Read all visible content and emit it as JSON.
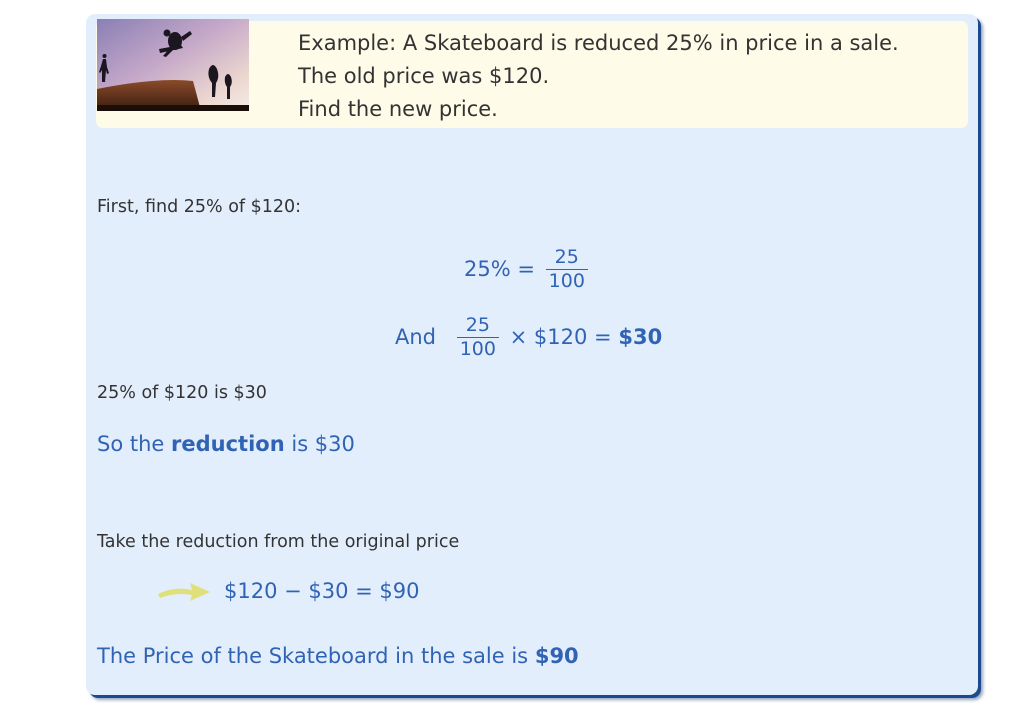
{
  "example": {
    "line1": "Example: A Skateboard is reduced 25% in price in a sale.",
    "line2": "The old price was $120.",
    "line3": "Find the new price."
  },
  "steps": {
    "first": "First, find 25% of $120:",
    "eq1": {
      "left": "25% =",
      "num": "25",
      "den": "100"
    },
    "eq2": {
      "prefix": "And",
      "num": "25",
      "den": "100",
      "middle": "× $120 =",
      "result": "$30"
    },
    "statement": "25% of $120 is $30",
    "reduction": {
      "prefix": "So the",
      "keyword": "reduction",
      "suffix": "is $30"
    },
    "take": "Take the reduction from the original price",
    "subtraction": "$120 − $30 = $90",
    "final": {
      "prefix": "The Price of the Skateboard in the sale is",
      "result": "$90"
    }
  },
  "colors": {
    "card_bg": "#e3eefc",
    "example_bg": "#fefbe8",
    "text_blue": "#3163b5",
    "text_dark": "#333333",
    "arrow": "#dfe07a",
    "shadow": "#1c4a8e"
  },
  "icons": {
    "photo": "skateboarder-photo",
    "arrow": "yellow-arrow-icon"
  }
}
